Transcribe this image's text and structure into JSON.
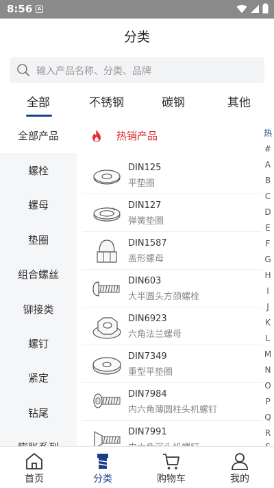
{
  "status_bar": {
    "time": "8:56",
    "notification_icon": "A"
  },
  "header": {
    "title": "分类"
  },
  "search": {
    "placeholder": "输入产品名称、分类、品牌"
  },
  "tabs": [
    {
      "label": "全部",
      "active": true
    },
    {
      "label": "不锈钢",
      "active": false
    },
    {
      "label": "碳钢",
      "active": false
    },
    {
      "label": "其他",
      "active": false
    }
  ],
  "categories": [
    {
      "label": "全部产品",
      "active": true
    },
    {
      "label": "螺栓",
      "active": false
    },
    {
      "label": "螺母",
      "active": false
    },
    {
      "label": "垫圈",
      "active": false
    },
    {
      "label": "组合螺丝",
      "active": false
    },
    {
      "label": "铆接类",
      "active": false
    },
    {
      "label": "螺钉",
      "active": false
    },
    {
      "label": "紧定",
      "active": false
    },
    {
      "label": "钻尾",
      "active": false
    },
    {
      "label": "膨胀系列",
      "active": false
    }
  ],
  "section": {
    "title": "热销产品",
    "icon": "flame-icon"
  },
  "products": [
    {
      "code": "DIN125",
      "name": "平垫圈",
      "icon": "flat-washer"
    },
    {
      "code": "DIN127",
      "name": "弹簧垫圈",
      "icon": "spring-washer"
    },
    {
      "code": "DIN1587",
      "name": "盖形螺母",
      "icon": "cap-nut"
    },
    {
      "code": "DIN603",
      "name": "大半圆头方颈螺栓",
      "icon": "carriage-bolt"
    },
    {
      "code": "DIN6923",
      "name": "六角法兰螺母",
      "icon": "flange-nut"
    },
    {
      "code": "DIN7349",
      "name": "重型平垫圈",
      "icon": "heavy-washer"
    },
    {
      "code": "DIN7984",
      "name": "内六角薄圆柱头机螺钉",
      "icon": "socket-screw"
    },
    {
      "code": "DIN7991",
      "name": "内六角沉头机螺钉",
      "icon": "countersunk-screw"
    }
  ],
  "alpha_index": [
    "热",
    "#",
    "A",
    "B",
    "C",
    "D",
    "E",
    "F",
    "G",
    "H",
    "I",
    "J",
    "K",
    "L",
    "M",
    "N",
    "O",
    "P",
    "Q",
    "R",
    "S"
  ],
  "bottom_nav": [
    {
      "label": "首页",
      "icon": "home-icon",
      "active": false
    },
    {
      "label": "分类",
      "icon": "category-icon",
      "active": true
    },
    {
      "label": "购物车",
      "icon": "cart-icon",
      "active": false
    },
    {
      "label": "我的",
      "icon": "user-icon",
      "active": false
    }
  ],
  "colors": {
    "accent": "#1a3f8a",
    "hot": "#e02020",
    "nav_bg": "#f5f6f8",
    "status_bar": "#8a8a8a"
  }
}
